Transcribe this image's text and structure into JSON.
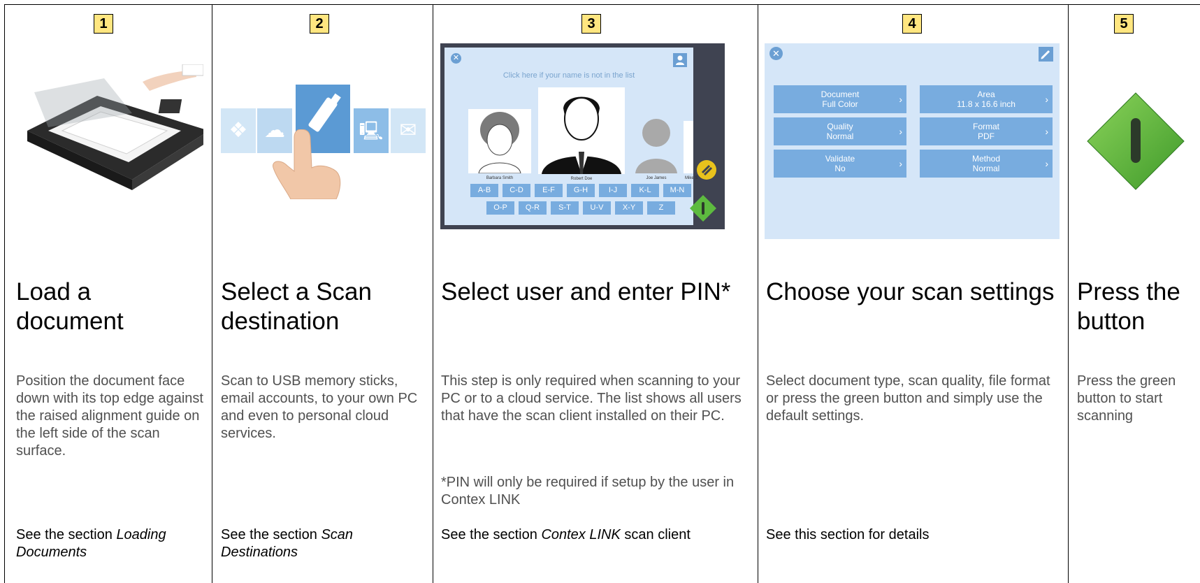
{
  "steps": [
    {
      "number": "1",
      "title": "Load a document",
      "description": "Position the document face down with its top edge against the raised alignment guide on the left side of the scan surface.",
      "ref_prefix": "See the section ",
      "ref_em": "Loading Documents",
      "ref_suffix": ""
    },
    {
      "number": "2",
      "title": "Select a Scan destination",
      "description": "Scan to USB memory sticks, email accounts, to your own PC and even to personal cloud services.",
      "ref_prefix": "See the section ",
      "ref_em": "Scan Destinations",
      "ref_suffix": ""
    },
    {
      "number": "3",
      "title": "Select user and enter PIN*",
      "description": "This step is only required when scanning to your PC or to a cloud service. The list shows all users that have the scan client installed on their PC.",
      "note": "*PIN will only be required if setup by the user in Contex LINK",
      "ref_prefix": "See the section ",
      "ref_em": "Contex LINK",
      "ref_suffix": " scan client"
    },
    {
      "number": "4",
      "title": "Choose your scan settings",
      "description": "Select document type, scan quality, file format or press the green button and simply use the default settings.",
      "ref_prefix": "See this section for details",
      "ref_em": "",
      "ref_suffix": ""
    },
    {
      "number": "5",
      "title": "Press the button",
      "description": "Press the green button to start scanning",
      "ref_prefix": "",
      "ref_em": "",
      "ref_suffix": ""
    }
  ],
  "user_screen": {
    "hint": "Click here if your name is not in the list",
    "users": [
      "Barbara Smith",
      "Robert Doe",
      "Joe James",
      "Mike S"
    ],
    "letters_row1": [
      "A-B",
      "C-D",
      "E-F",
      "G-H",
      "I-J",
      "K-L",
      "M-N"
    ],
    "letters_row2": [
      "O-P",
      "Q-R",
      "S-T",
      "U-V",
      "X-Y",
      "Z"
    ]
  },
  "settings_screen": {
    "options": [
      {
        "label": "Document",
        "value": "Full Color"
      },
      {
        "label": "Area",
        "value": "11.8 x 16.6 inch"
      },
      {
        "label": "Quality",
        "value": "Normal"
      },
      {
        "label": "Format",
        "value": "PDF"
      },
      {
        "label": "Validate",
        "value": "No"
      },
      {
        "label": "Method",
        "value": "Normal"
      }
    ]
  },
  "colors": {
    "badge": "#ffe680",
    "screen_bg": "#d5e6f8",
    "tile": "#78acdf",
    "start_green": "#5dbb3f"
  }
}
